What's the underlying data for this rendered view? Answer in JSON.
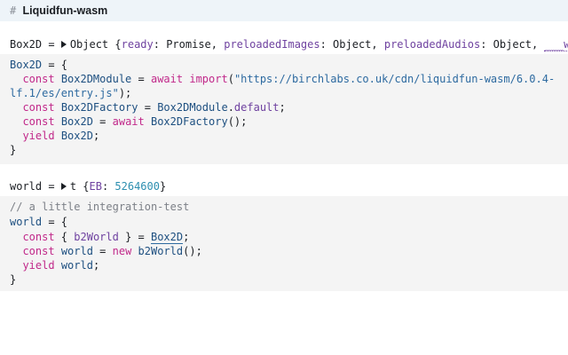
{
  "markdown_cell": {
    "hash": "#",
    "title": "Liquidfun-wasm"
  },
  "box2d_output": {
    "name": "Box2D",
    "eq": " = ",
    "type_label": "Object",
    "open": " {",
    "prop1": "ready",
    "val1": ": Promise, ",
    "prop2": "preloadedImages",
    "val2": ": Object, ",
    "prop3": "preloadedAudios",
    "val3": ": Object, ",
    "prop4": "___wasm_call_"
  },
  "box2d_code": {
    "l1_var": "Box2D",
    "l1_rest": " = {",
    "l2_indent": "  ",
    "l2_kw": "const",
    "l2_sp": " ",
    "l2_var": "Box2DModule",
    "l2_eq": " = ",
    "l2_await": "await",
    "l2_sp2": " ",
    "l2_import": "import",
    "l2_paren": "(",
    "l2_str_a": "\"https://birchlabs.co.uk/cdn/liquidfun-wasm/6.0.4-",
    "l3_str_b": "lf.1/es/entry.js\"",
    "l3_rest": ");",
    "l4_indent": "  ",
    "l4_kw": "const",
    "l4_sp": " ",
    "l4_var": "Box2DFactory",
    "l4_eq": " = ",
    "l4_obj": "Box2DModule",
    "l4_dot": ".",
    "l4_prop": "default",
    "l4_end": ";",
    "l5_indent": "  ",
    "l5_kw": "const",
    "l5_sp": " ",
    "l5_var": "Box2D",
    "l5_eq": " = ",
    "l5_await": "await",
    "l5_sp2": " ",
    "l5_fn": "Box2DFactory",
    "l5_end": "();",
    "l6_indent": "  ",
    "l6_kw": "yield",
    "l6_sp": " ",
    "l6_var": "Box2D",
    "l6_end": ";",
    "l7": "}"
  },
  "world_output": {
    "name": "world",
    "eq": " = ",
    "type_label": "t",
    "open": " {",
    "prop": "EB",
    "colon": ": ",
    "value": "5264600",
    "close": "}"
  },
  "world_code": {
    "l1_comment": "// a little integration-test",
    "l2_var": "world",
    "l2_rest": " = {",
    "l3_indent": "  ",
    "l3_kw": "const",
    "l3_open": " { ",
    "l3_prop": "b2World",
    "l3_close": " } = ",
    "l3_ref": "Box2D",
    "l3_end": ";",
    "l4_indent": "  ",
    "l4_kw": "const",
    "l4_sp": " ",
    "l4_var": "world",
    "l4_eq": " = ",
    "l4_new": "new",
    "l4_sp2": " ",
    "l4_fn": "b2World",
    "l4_end": "();",
    "l5_indent": "  ",
    "l5_kw": "yield",
    "l5_sp": " ",
    "l5_var": "world",
    "l5_end": ";",
    "l6": "}"
  }
}
